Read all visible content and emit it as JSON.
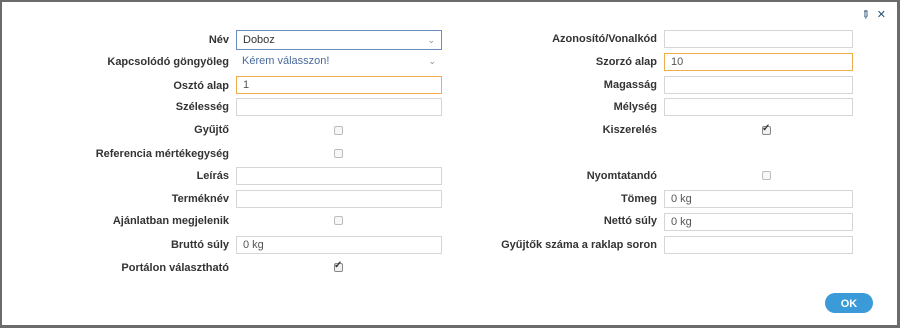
{
  "dialog": {
    "ok_label": "OK"
  },
  "fields_left": [
    {
      "label": "Név",
      "value": "Doboz"
    },
    {
      "label": "Kapcsolódó göngyöleg",
      "value": "Kérem válasszon!"
    },
    {
      "label": "Osztó alap",
      "value": "1"
    },
    {
      "label": "Szélesség",
      "value": ""
    },
    {
      "label": "Gyűjtő",
      "checked": false
    },
    {
      "label": "Referencia mértékegység",
      "checked": false
    },
    {
      "label": "Leírás",
      "value": ""
    },
    {
      "label": "Terméknév",
      "value": ""
    },
    {
      "label": "Ajánlatban megjelenik",
      "checked": false
    },
    {
      "label": "Bruttó súly",
      "value": "0 kg"
    },
    {
      "label": "Portálon választható",
      "checked": true
    }
  ],
  "fields_right": [
    {
      "label": "Azonosító/Vonalkód",
      "value": ""
    },
    {
      "label": "Szorzó alap",
      "value": "10"
    },
    {
      "label": "Magasság",
      "value": ""
    },
    {
      "label": "Mélység",
      "value": ""
    },
    {
      "label": "Kiszerelés",
      "checked": true
    },
    {
      "label": "Nyomtatandó",
      "checked": false
    },
    {
      "label": "Tömeg",
      "value": "0 kg"
    },
    {
      "label": "Nettó súly",
      "value": "0 kg"
    },
    {
      "label": "Gyűjtők száma a raklap soron",
      "value": ""
    }
  ],
  "icons": {
    "edit": "pencil-icon",
    "close": "close-icon"
  }
}
